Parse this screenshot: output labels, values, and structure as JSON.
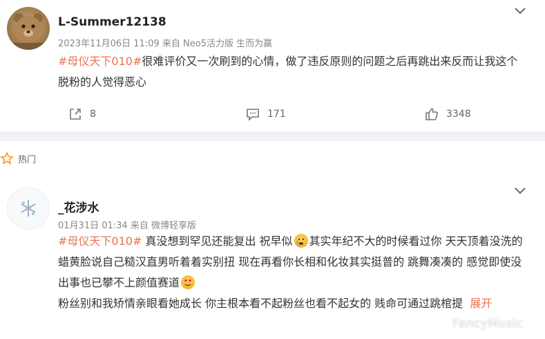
{
  "post": {
    "username": "L-Summer12138",
    "meta": "2023年11月06日 11:09  来自 Neo5活力版 生而为赢",
    "topic": "#母仪天下010#",
    "text": "很难评价又一次刷到的心情，做了违反原则的问题之后再跳出来反而让我这个脱粉的人觉得恶心",
    "actions": {
      "repost_count": "8",
      "comment_count": "171",
      "like_count": "3348"
    },
    "icons": {
      "repost": "share-icon",
      "comment": "comment-icon",
      "like": "thumbs-up-icon",
      "menu": "chevron-down-icon"
    }
  },
  "section": {
    "label": "热门",
    "icon": "star-icon"
  },
  "comment": {
    "username": "_花涉水",
    "meta": "01月31日 01:34  来自 微博轻享版",
    "topic": "#母仪天下010#",
    "text_part1": " 真没想到罕见还能复出 祝早似",
    "text_part2": "其实年纪不大的时候看过你 天天顶着没洗的蜡黄脸说自己糙汉直男听着着实别扭 现在再看你长相和化妆其实挺普的 跳舞凑凑的 感觉即使没出事也已攀不上颜值赛道",
    "text_part3": "粉丝别和我矫情亲眼看她成长 你主根本看不起粉丝也看不起女的 贱命可通过跳棺提",
    "expand_label": "展开",
    "emoji1": "crying-face-emoji",
    "emoji2": "heart-eyes-emoji"
  },
  "watermark": "FancyMusic"
}
